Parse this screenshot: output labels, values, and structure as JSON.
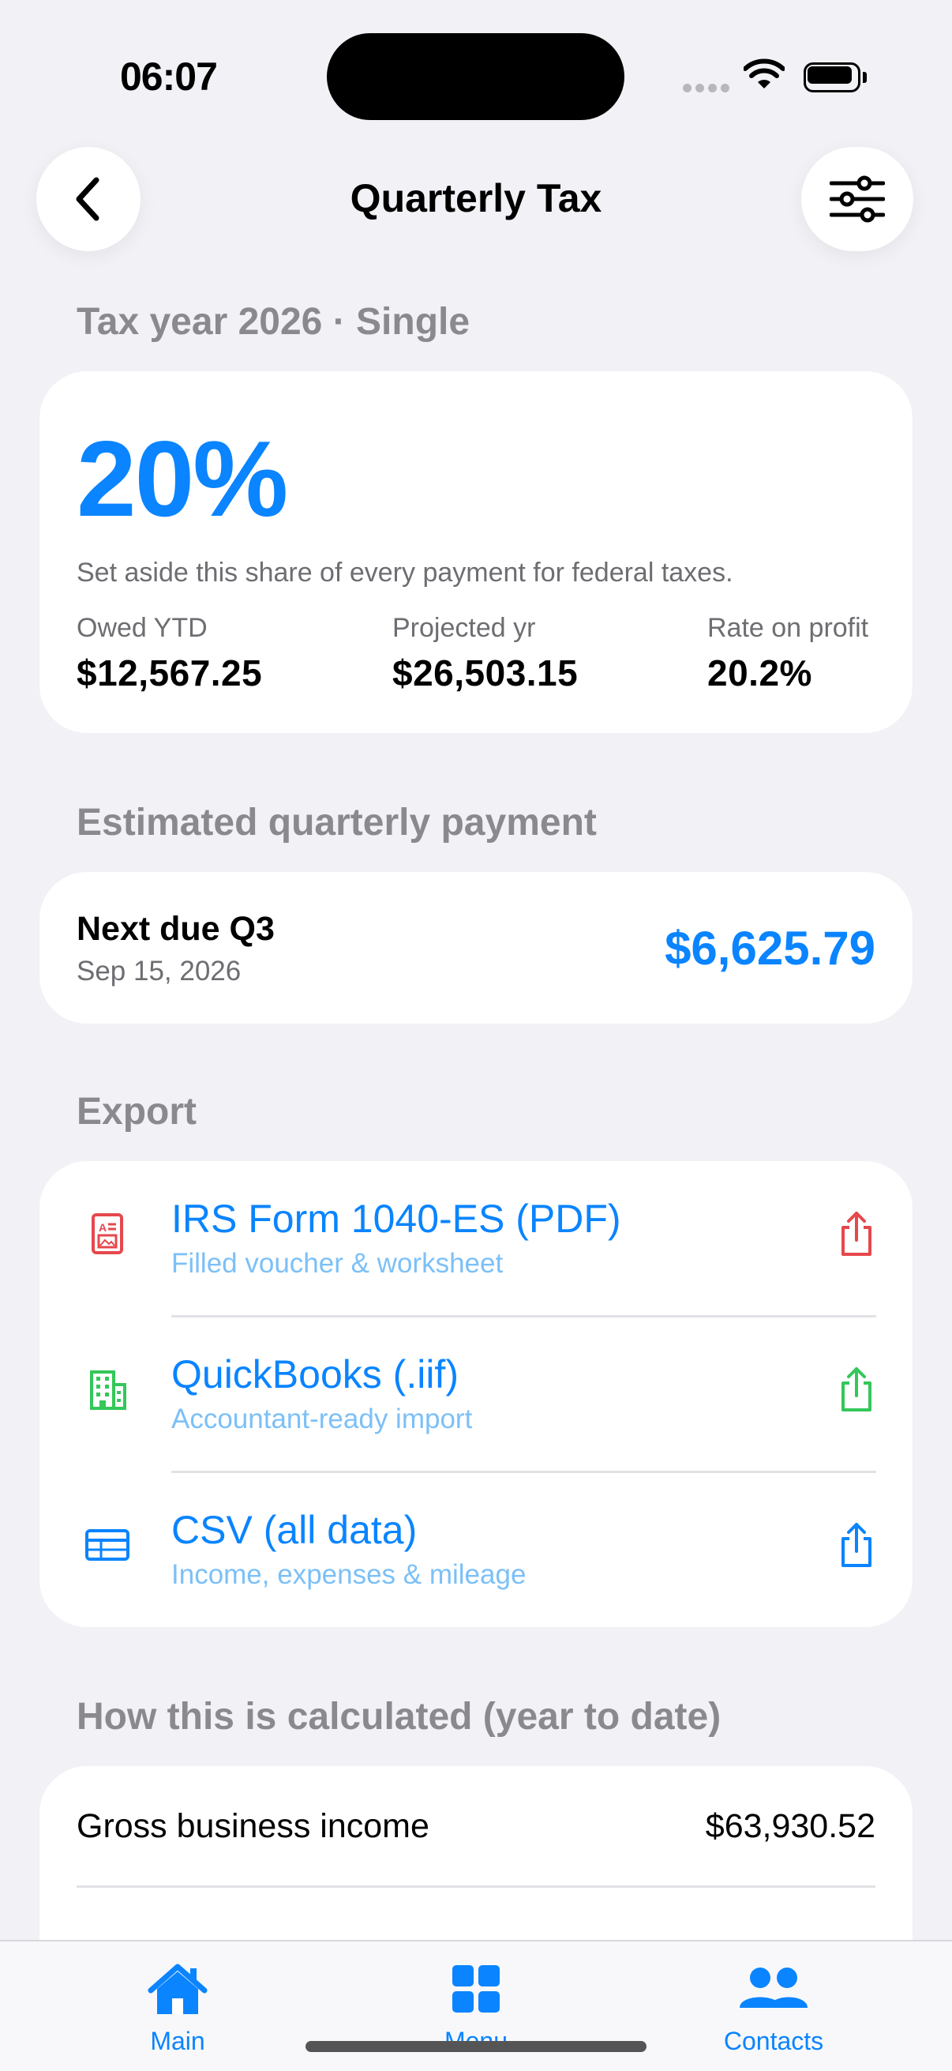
{
  "status_bar": {
    "time": "06:07"
  },
  "nav": {
    "title": "Quarterly Tax"
  },
  "summary": {
    "section_label": "Tax year 2026 · Single",
    "rate": "20%",
    "description": "Set aside this share of every payment for federal taxes.",
    "stats": [
      {
        "label": "Owed YTD",
        "value": "$12,567.25"
      },
      {
        "label": "Projected yr",
        "value": "$26,503.15"
      },
      {
        "label": "Rate on profit",
        "value": "20.2%"
      }
    ]
  },
  "quarterly": {
    "section_label": "Estimated quarterly payment",
    "title": "Next due Q3",
    "date": "Sep 15, 2026",
    "amount": "$6,625.79"
  },
  "export": {
    "section_label": "Export",
    "items": [
      {
        "title": "IRS Form 1040-ES (PDF)",
        "subtitle": "Filled voucher & worksheet",
        "icon": "pdf-form-icon",
        "color": "#e5484d"
      },
      {
        "title": "QuickBooks (.iif)",
        "subtitle": "Accountant-ready import",
        "icon": "building-icon",
        "color": "#34c759"
      },
      {
        "title": "CSV (all data)",
        "subtitle": "Income, expenses & mileage",
        "icon": "table-icon",
        "color": "#0a84ff"
      }
    ]
  },
  "calculation": {
    "section_label": "How this is calculated (year to date)",
    "rows": [
      {
        "label": "Gross business income",
        "value": "$63,930.52"
      }
    ]
  },
  "tab_bar": {
    "tabs": [
      {
        "label": "Main",
        "icon": "home-icon"
      },
      {
        "label": "Menu",
        "icon": "grid-icon"
      },
      {
        "label": "Contacts",
        "icon": "people-icon"
      }
    ]
  },
  "colors": {
    "accent": "#0a84ff",
    "background": "#f1f1f6"
  }
}
